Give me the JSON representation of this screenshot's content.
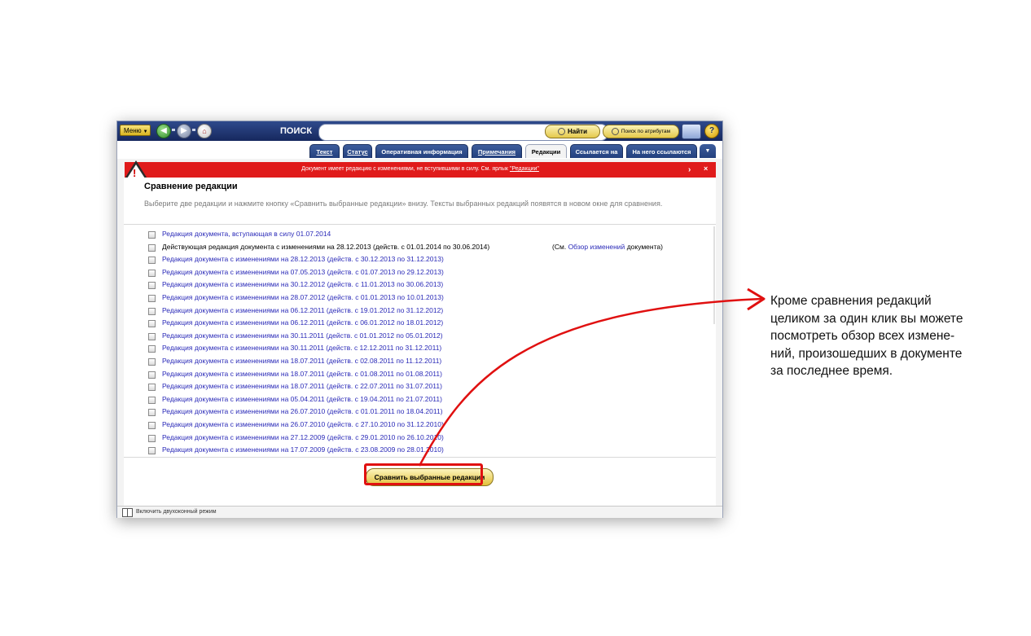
{
  "toolbar": {
    "menu_label": "Меню",
    "search_label": "ПОИСК",
    "search_value": "",
    "find_label": "Найти",
    "attr_search_label": "Поиск по атрибутам"
  },
  "tabs": [
    {
      "label": "Текст",
      "active": false
    },
    {
      "label": "Статус",
      "active": false
    },
    {
      "label": "Оперативная информация",
      "active": false
    },
    {
      "label": "Примечания",
      "active": false
    },
    {
      "label": "Редакции",
      "active": true
    },
    {
      "label": "Ссылается на",
      "active": false
    },
    {
      "label": "На него ссылаются",
      "active": false
    }
  ],
  "warning": {
    "text": "Документ имеет редакцию с изменениями, не вступившими в силу. См. ярлык",
    "link": "\"Редакции\""
  },
  "main": {
    "title": "Сравнение редакции",
    "subtitle": "Выберите две редакции и нажмите кнопку «Сравнить выбранные редакции» внизу. Тексты выбранных редакций появятся в новом окне для сравнения.",
    "note_prefix": "(См.",
    "note_link": "Обзор изменений",
    "note_suffix": "документа)",
    "revisions": [
      {
        "text": "Редакция документа, вступающая в силу 01.07.2014",
        "link": true
      },
      {
        "text": "Действующая редакция документа с изменениями на 28.12.2013 (действ. с 01.01.2014 по 30.06.2014)",
        "link": false
      },
      {
        "text": "Редакция документа с изменениями на 28.12.2013 (действ. с 30.12.2013 по 31.12.2013)",
        "link": true
      },
      {
        "text": "Редакция документа с изменениями на 07.05.2013 (действ. с 01.07.2013 по 29.12.2013)",
        "link": true
      },
      {
        "text": "Редакция документа с изменениями на 30.12.2012 (действ. с 11.01.2013 по 30.06.2013)",
        "link": true
      },
      {
        "text": "Редакция документа с изменениями на 28.07.2012 (действ. с 01.01.2013 по 10.01.2013)",
        "link": true
      },
      {
        "text": "Редакция документа с изменениями на 06.12.2011 (действ. с 19.01.2012 по 31.12.2012)",
        "link": true
      },
      {
        "text": "Редакция документа с изменениями на 06.12.2011 (действ. с 06.01.2012 по 18.01.2012)",
        "link": true
      },
      {
        "text": "Редакция документа с изменениями на 30.11.2011 (действ. с 01.01.2012 по 05.01.2012)",
        "link": true
      },
      {
        "text": "Редакция документа с изменениями на 30.11.2011 (действ. с 12.12.2011 по 31.12.2011)",
        "link": true
      },
      {
        "text": "Редакция документа с изменениями на 18.07.2011 (действ. с 02.08.2011 по 11.12.2011)",
        "link": true
      },
      {
        "text": "Редакция документа с изменениями на 18.07.2011 (действ. с 01.08.2011 по 01.08.2011)",
        "link": true
      },
      {
        "text": "Редакция документа с изменениями на 18.07.2011 (действ. с 22.07.2011 по 31.07.2011)",
        "link": true
      },
      {
        "text": "Редакция документа с изменениями на 05.04.2011 (действ. с 19.04.2011 по 21.07.2011)",
        "link": true
      },
      {
        "text": "Редакция документа с изменениями на 26.07.2010 (действ. с 01.01.2011 по 18.04.2011)",
        "link": true
      },
      {
        "text": "Редакция документа с изменениями на 26.07.2010 (действ. с 27.10.2010 по 31.12.2010)",
        "link": true
      },
      {
        "text": "Редакция документа с изменениями на 27.12.2009 (действ. с 29.01.2010 по 26.10.2010)",
        "link": true
      },
      {
        "text": "Редакция документа с изменениями на 17.07.2009 (действ. с 23.08.2009 по 28.01.2010)",
        "link": true
      }
    ],
    "compare_button": "Сравнить выбранные редакции"
  },
  "statusbar": {
    "two_window_label": "Включить двухоконный режим"
  },
  "annotation": {
    "lines": [
      "Кроме сравнения редакций",
      "целиком за один клик вы можете",
      "посмотреть обзор всех измене-",
      "ний, произошедших в документе",
      "за последнее время."
    ]
  },
  "colors": {
    "toolbar": "#1f3470",
    "warning": "#e01b1b",
    "link": "#2a2ab8",
    "highlight": "#e01010"
  }
}
